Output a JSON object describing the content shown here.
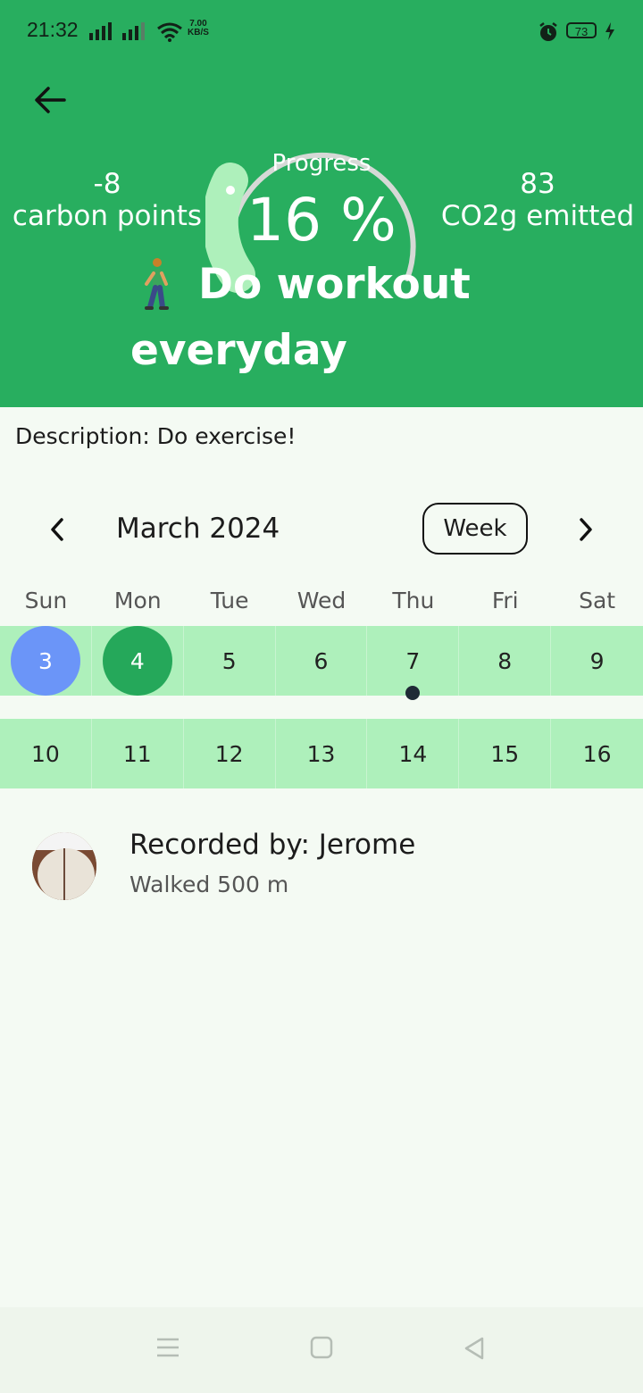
{
  "status_bar": {
    "time": "21:32",
    "speed_value": "7.00",
    "speed_unit": "KB/S",
    "battery": "73"
  },
  "header": {
    "carbon_points_value": "-8",
    "carbon_points_label": "carbon points",
    "progress_label": "Progress",
    "progress_value": "16 %",
    "progress_fraction": 0.16,
    "co2_value": "83",
    "co2_label": "CO2g emitted",
    "title": "Do workout everyday"
  },
  "description": "Description: Do exercise!",
  "calendar": {
    "month": "March 2024",
    "view_button": "Week",
    "weekdays": [
      "Sun",
      "Mon",
      "Tue",
      "Wed",
      "Thu",
      "Fri",
      "Sat"
    ],
    "weeks": [
      [
        "3",
        "4",
        "5",
        "6",
        "7",
        "8",
        "9"
      ],
      [
        "10",
        "11",
        "12",
        "13",
        "14",
        "15",
        "16"
      ]
    ],
    "today": "3",
    "selected": "4",
    "event_day": "7"
  },
  "record": {
    "title": "Recorded by: Jerome",
    "subtitle": "Walked 500 m"
  },
  "colors": {
    "primary_green": "#28ae5f",
    "light_green": "#aef0bb",
    "today_blue": "#6b95f8",
    "background": "#f4faf3"
  }
}
